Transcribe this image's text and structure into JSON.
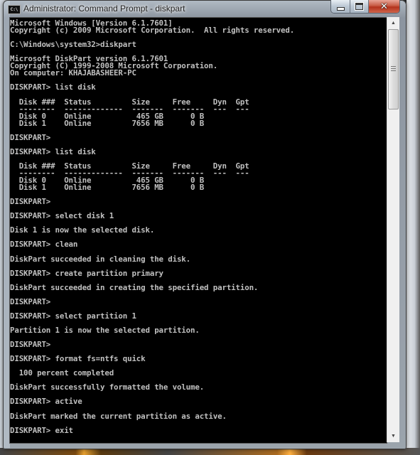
{
  "window": {
    "title": "Administrator: Command Prompt - diskpart",
    "app_icon_text": "C:\\",
    "caption_buttons": {
      "minimize": "minimize",
      "maximize": "maximize",
      "close": "✕"
    }
  },
  "console": {
    "text_color": "#c0c0c0",
    "background_color": "#000000",
    "lines": [
      "Microsoft Windows [Version 6.1.7601]",
      "Copyright (c) 2009 Microsoft Corporation.  All rights reserved.",
      "",
      "C:\\Windows\\system32>diskpart",
      "",
      "Microsoft DiskPart version 6.1.7601",
      "Copyright (C) 1999-2008 Microsoft Corporation.",
      "On computer: KHAJABASHEER-PC",
      "",
      "DISKPART> list disk",
      "",
      "  Disk ###  Status         Size     Free     Dyn  Gpt",
      "  --------  -------------  -------  -------  ---  ---",
      "  Disk 0    Online          465 GB      0 B",
      "  Disk 1    Online         7656 MB      0 B",
      "",
      "DISKPART>",
      "",
      "DISKPART> list disk",
      "",
      "  Disk ###  Status         Size     Free     Dyn  Gpt",
      "  --------  -------------  -------  -------  ---  ---",
      "  Disk 0    Online          465 GB      0 B",
      "  Disk 1    Online         7656 MB      0 B",
      "",
      "DISKPART>",
      "",
      "DISKPART> select disk 1",
      "",
      "Disk 1 is now the selected disk.",
      "",
      "DISKPART> clean",
      "",
      "DiskPart succeeded in cleaning the disk.",
      "",
      "DISKPART> create partition primary",
      "",
      "DiskPart succeeded in creating the specified partition.",
      "",
      "DISKPART>",
      "",
      "DISKPART> select partition 1",
      "",
      "Partition 1 is now the selected partition.",
      "",
      "DISKPART>",
      "",
      "DISKPART> format fs=ntfs quick",
      "",
      "  100 percent completed",
      "",
      "DiskPart successfully formatted the volume.",
      "",
      "DISKPART> active",
      "",
      "DiskPart marked the current partition as active.",
      "",
      "DISKPART> exit"
    ]
  },
  "scrollbar": {
    "up_arrow": "▲",
    "down_arrow": "▼",
    "position_fraction": 0.0
  }
}
